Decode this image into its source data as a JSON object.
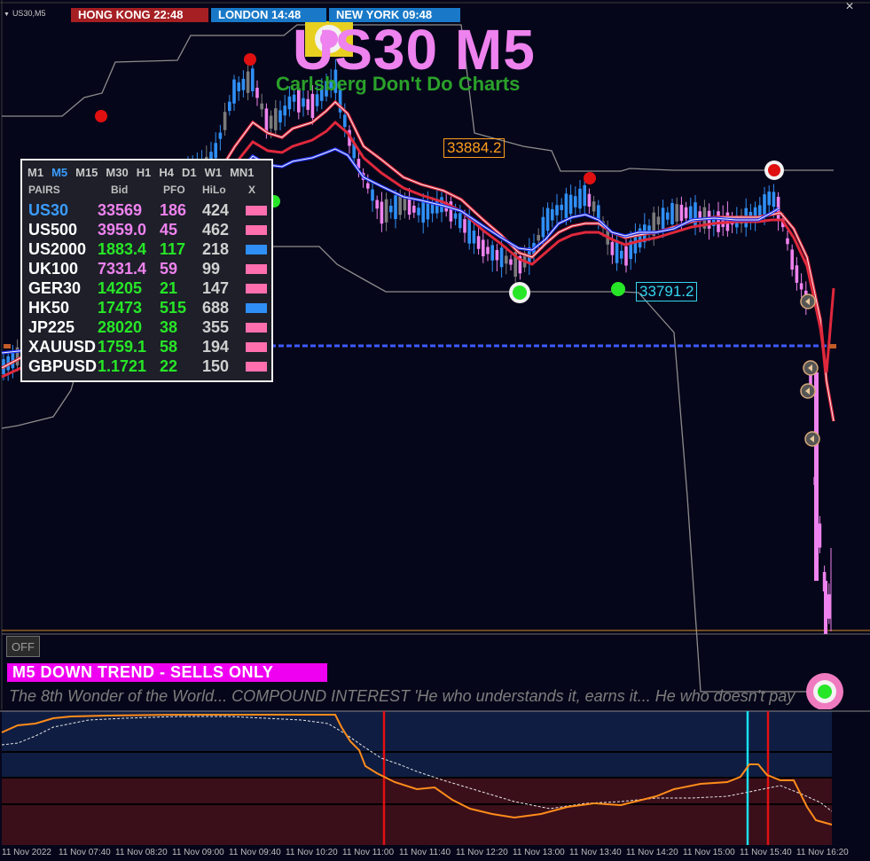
{
  "window": {
    "symbol_label": "US30,M5"
  },
  "sessions": [
    {
      "label": "HONG KONG 22:48"
    },
    {
      "label": "LONDON  14:48"
    },
    {
      "label": "NEW YORK  09:48"
    }
  ],
  "title": {
    "main": "US30 M5",
    "subtitle": "Carlsberg Don't Do Charts"
  },
  "price_labels": {
    "high": "33884.2",
    "low": "33791.2"
  },
  "panel": {
    "timeframes": [
      "M1",
      "M5",
      "M15",
      "M30",
      "H1",
      "H4",
      "D1",
      "W1",
      "MN1"
    ],
    "active_timeframe": "M5",
    "headers": {
      "pairs": "PAIRS",
      "bid": "Bid",
      "pfo": "PFO",
      "hilo": "HiLo",
      "x": "X"
    },
    "rows": [
      {
        "pair": "US30",
        "bid": "33569",
        "pfo": "186",
        "hilo": "424",
        "color": "#ff6fae",
        "pair_color": "#3a9cff",
        "bid_color": "#ee82ee",
        "pfo_color": "#ee82ee"
      },
      {
        "pair": "US500",
        "bid": "3959.0",
        "pfo": "45",
        "hilo": "462",
        "color": "#ff6fae",
        "pair_color": "#ffffff",
        "bid_color": "#ee82ee",
        "pfo_color": "#ee82ee"
      },
      {
        "pair": "US2000",
        "bid": "1883.4",
        "pfo": "117",
        "hilo": "218",
        "color": "#2f8ff5",
        "pair_color": "#ffffff",
        "bid_color": "#27e627",
        "pfo_color": "#27e627"
      },
      {
        "pair": "UK100",
        "bid": "7331.4",
        "pfo": "59",
        "hilo": "99",
        "color": "#ff6fae",
        "pair_color": "#ffffff",
        "bid_color": "#ee82ee",
        "pfo_color": "#ee82ee"
      },
      {
        "pair": "GER30",
        "bid": "14205",
        "pfo": "21",
        "hilo": "147",
        "color": "#ff6fae",
        "pair_color": "#ffffff",
        "bid_color": "#27e627",
        "pfo_color": "#27e627"
      },
      {
        "pair": "HK50",
        "bid": "17473",
        "pfo": "515",
        "hilo": "688",
        "color": "#2f8ff5",
        "pair_color": "#ffffff",
        "bid_color": "#27e627",
        "pfo_color": "#27e627"
      },
      {
        "pair": "JP225",
        "bid": "28020",
        "pfo": "38",
        "hilo": "355",
        "color": "#ff6fae",
        "pair_color": "#ffffff",
        "bid_color": "#27e627",
        "pfo_color": "#27e627"
      },
      {
        "pair": "XAUUSD",
        "bid": "1759.1",
        "pfo": "58",
        "hilo": "194",
        "color": "#ff6fae",
        "pair_color": "#ffffff",
        "bid_color": "#27e627",
        "pfo_color": "#27e627"
      },
      {
        "pair": "GBPUSD",
        "bid": "1.1721",
        "pfo": "22",
        "hilo": "150",
        "color": "#ff6fae",
        "pair_color": "#ffffff",
        "bid_color": "#27e627",
        "pfo_color": "#27e627"
      }
    ]
  },
  "controls": {
    "off_label": "OFF"
  },
  "trend_banner": "M5  DOWN TREND - SELLS ONLY",
  "ticker_text": "The 8th Wonder of the World... COMPOUND INTEREST  'He who understands it, earns it... He who doesn't pay",
  "time_axis": [
    "11 Nov 2022",
    "11 Nov 07:40",
    "11 Nov 08:20",
    "11 Nov 09:00",
    "11 Nov 09:40",
    "11 Nov 10:20",
    "11 Nov 11:00",
    "11 Nov 11:40",
    "11 Nov 12:20",
    "11 Nov 13:00",
    "11 Nov 13:40",
    "11 Nov 14:20",
    "11 Nov 15:00",
    "11 Nov 15:40",
    "11 Nov 16:20"
  ],
  "colors": {
    "background": "#06061a",
    "bull": "#2f8ff5",
    "bear": "#ee82ee",
    "ma_red": "#e0283c",
    "ma_blue": "#2233ee",
    "support": "#27e627",
    "resistance": "#e01010"
  },
  "icons": {
    "close": "close-icon",
    "dropdown": "dropdown-arrow-icon"
  }
}
